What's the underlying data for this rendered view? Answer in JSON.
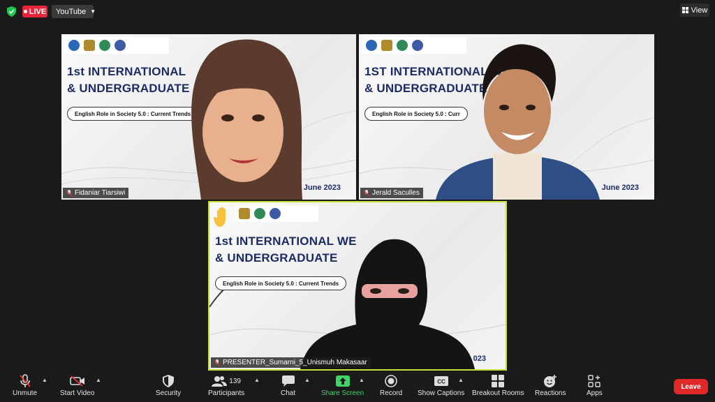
{
  "topbar": {
    "live_label": "LIVE",
    "stream_label": "YouTube",
    "view_label": "View"
  },
  "tiles": [
    {
      "title_line1": "1st INTERNATIONAL",
      "title_line2": "& UNDERGRADUATE",
      "subtitle": "English Role in Society 5.0 : Current Trends",
      "date": "June 2023",
      "participant": "Fidaniar Tiarsiwi"
    },
    {
      "title_line1": "1ST INTERNATIONAL WEBINAR",
      "title_line2": "& UNDERGRADUATE",
      "subtitle": "English Role in Society 5.0 : Curr",
      "date": "June 2023",
      "participant": "Jerald Saculles"
    },
    {
      "title_line1": "1st INTERNATIONAL WE",
      "title_line2": "& UNDERGRADUATE",
      "subtitle": "English Role in Society 5.0 : Current Trends",
      "date": "023",
      "participant": "PRESENTER_Sumarni_5_Unismuh Makasaar"
    }
  ],
  "toolbar": {
    "unmute": "Unmute",
    "start_video": "Start Video",
    "security": "Security",
    "participants": "Participants",
    "participants_count": "139",
    "chat": "Chat",
    "share_screen": "Share Screen",
    "record": "Record",
    "show_captions": "Show Captions",
    "breakout_rooms": "Breakout Rooms",
    "reactions": "Reactions",
    "apps": "Apps",
    "leave": "Leave"
  },
  "colors": {
    "live": "#e8263a",
    "active_speaker": "#c4e13a",
    "share": "#3fd46a",
    "leave": "#e02828",
    "slide_title": "#1c2b66"
  }
}
